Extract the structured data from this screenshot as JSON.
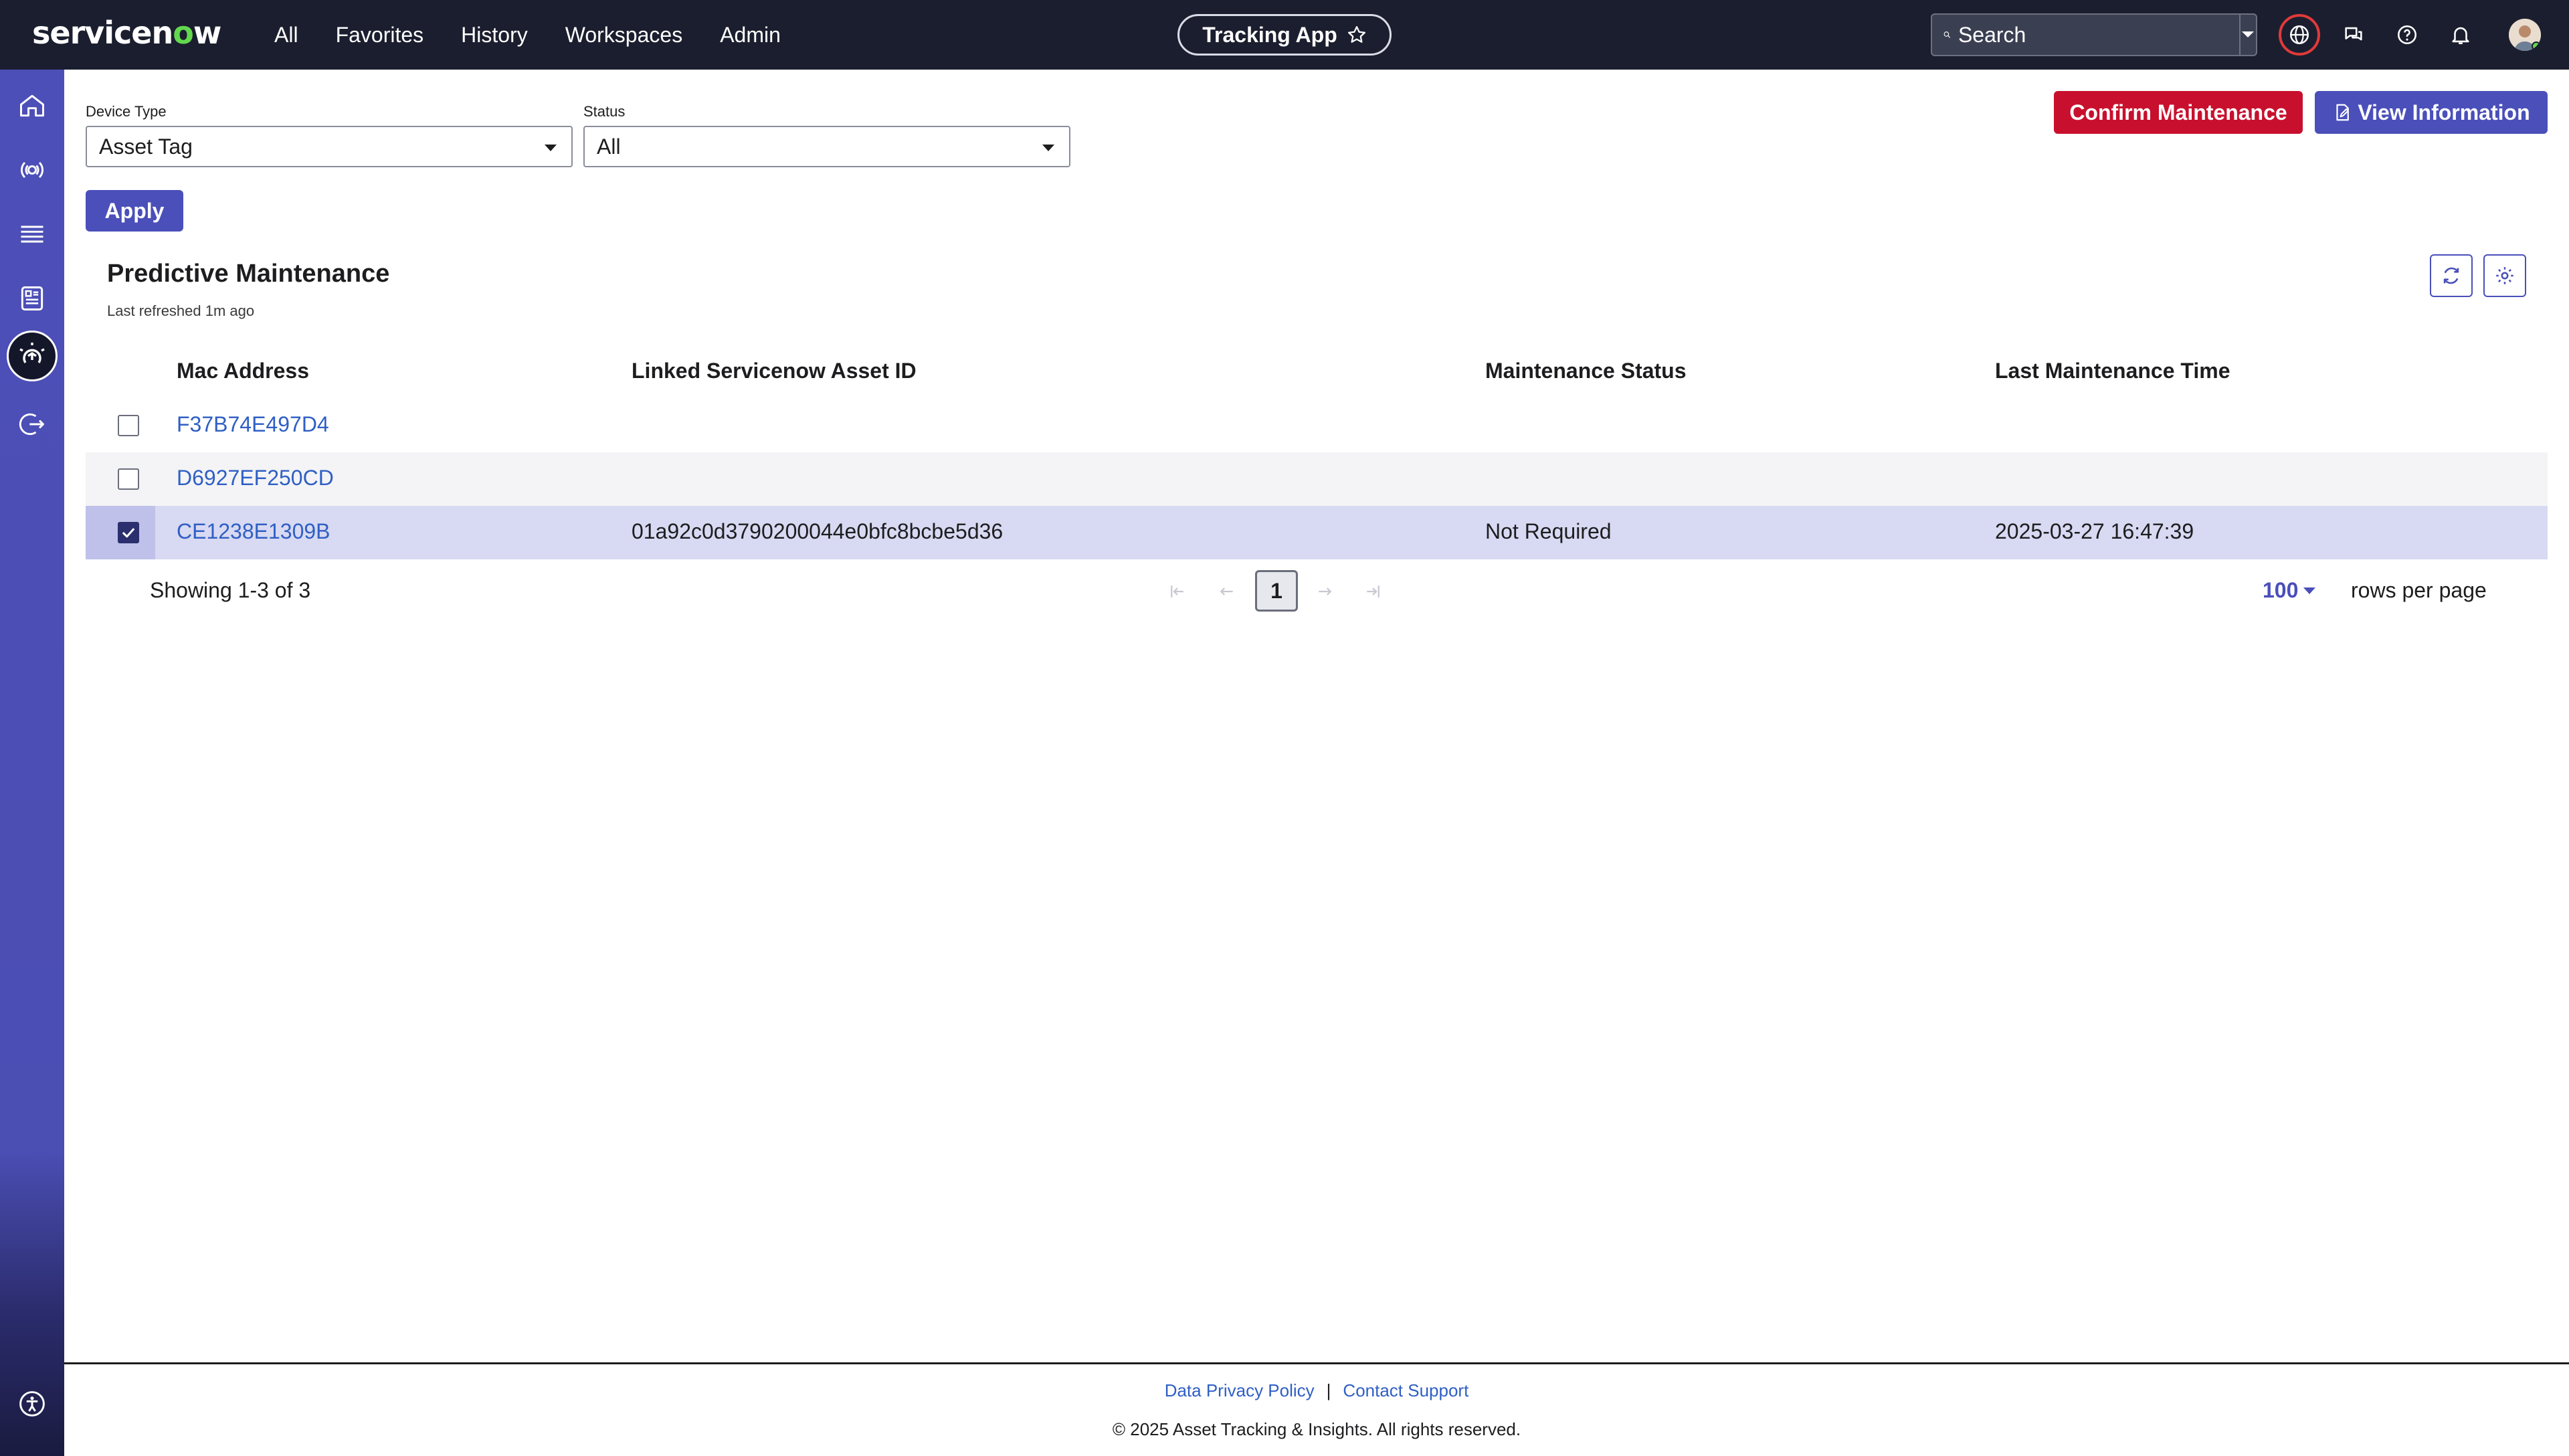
{
  "brand": {
    "logo_text_a": "servicen",
    "logo_text_o": "o",
    "logo_text_b": "w"
  },
  "nav": {
    "items": [
      "All",
      "Favorites",
      "History",
      "Workspaces",
      "Admin"
    ]
  },
  "app": {
    "title": "Tracking App"
  },
  "search": {
    "placeholder": "Search"
  },
  "filters": {
    "device_type_label": "Device Type",
    "device_type_value": "Asset Tag",
    "status_label": "Status",
    "status_value": "All",
    "apply_label": "Apply"
  },
  "actions": {
    "confirm_label": "Confirm Maintenance",
    "view_label": "View Information"
  },
  "card": {
    "title": "Predictive Maintenance",
    "subtitle": "Last refreshed 1m ago"
  },
  "table": {
    "columns": [
      "Mac Address",
      "Linked Servicenow Asset ID",
      "Maintenance Status",
      "Last Maintenance Time"
    ],
    "rows": [
      {
        "mac": "F37B74E497D4",
        "asset_id": "",
        "status": "",
        "time": "",
        "checked": false
      },
      {
        "mac": "D6927EF250CD",
        "asset_id": "",
        "status": "",
        "time": "",
        "checked": false
      },
      {
        "mac": "CE1238E1309B",
        "asset_id": "01a92c0d3790200044e0bfc8bcbe5d36",
        "status": "Not Required",
        "time": "2025-03-27 16:47:39",
        "checked": true
      }
    ]
  },
  "pagination": {
    "showing": "Showing 1-3 of 3",
    "current_page": "1",
    "rows_per_page": "100",
    "rows_per_page_label": "rows per page"
  },
  "footer": {
    "privacy": "Data Privacy Policy",
    "separator": "|",
    "support": "Contact Support",
    "copyright": "© 2025 Asset Tracking & Insights. All rights reserved."
  },
  "colors": {
    "topbar": "#1b1e2e",
    "sidebar": "#4d4fb8",
    "accent": "#4a4fba",
    "danger": "#c8102e",
    "link": "#2f5fc4",
    "selected_row": "#d8d9f2"
  }
}
